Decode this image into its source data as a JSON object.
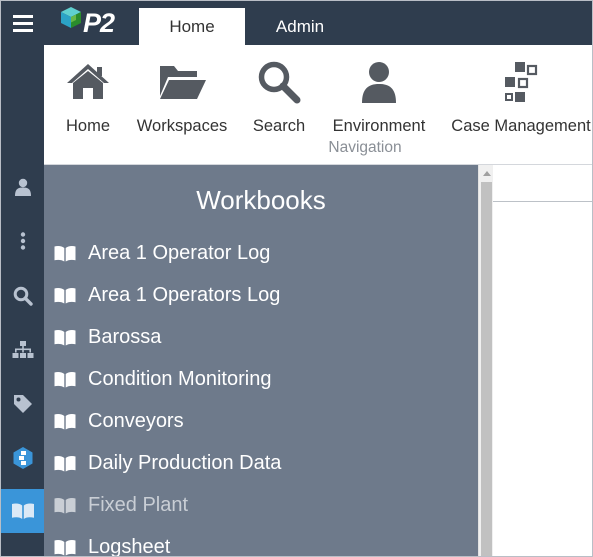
{
  "app": {
    "logo_text": "P2",
    "logo_icon": "p2-cube-logo"
  },
  "tabs": [
    {
      "label": "Home",
      "active": true
    },
    {
      "label": "Admin",
      "active": false
    }
  ],
  "ribbon": {
    "buttons": [
      {
        "label": "Home",
        "icon": "house-icon"
      },
      {
        "label": "Workspaces",
        "icon": "folder-open-icon"
      },
      {
        "label": "Search",
        "icon": "magnifier-icon"
      },
      {
        "label": "Environment",
        "icon": "user-icon"
      },
      {
        "label": "Case Management",
        "icon": "case-flow-icon"
      }
    ],
    "group_label": "Navigation"
  },
  "sidebar": {
    "items": [
      {
        "icon": "user-icon",
        "active": false
      },
      {
        "icon": "vertical-ellipsis-icon",
        "active": false
      },
      {
        "icon": "search-icon",
        "active": false
      },
      {
        "icon": "hierarchy-icon",
        "active": false
      },
      {
        "icon": "tag-icon",
        "active": false
      },
      {
        "icon": "hex-case-icon",
        "active": false
      },
      {
        "icon": "book-open-icon",
        "active": true
      }
    ]
  },
  "workbooks": {
    "title": "Workbooks",
    "items": [
      {
        "name": "Area 1 Operator Log",
        "muted": false
      },
      {
        "name": "Area 1 Operators Log",
        "muted": false
      },
      {
        "name": "Barossa",
        "muted": false
      },
      {
        "name": "Condition Monitoring",
        "muted": false
      },
      {
        "name": "Conveyors",
        "muted": false
      },
      {
        "name": "Daily Production Data",
        "muted": false
      },
      {
        "name": "Fixed Plant",
        "muted": true
      },
      {
        "name": "Logsheet",
        "muted": false
      }
    ]
  },
  "colors": {
    "chrome": "#2f3d4e",
    "accent": "#3a95d9",
    "panel": "#6e7a8b",
    "ribbon_icon": "#555a61",
    "sidebar_icon": "#b8c2d0"
  }
}
